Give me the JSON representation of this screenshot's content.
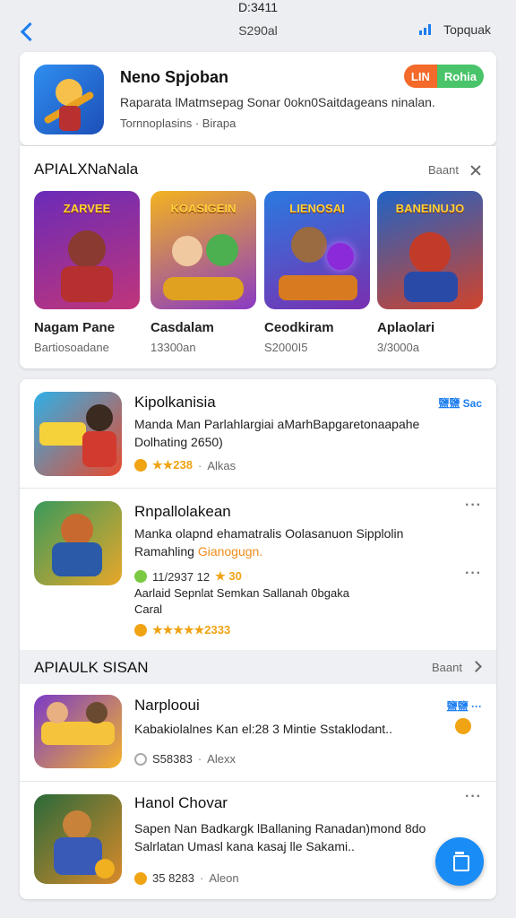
{
  "status": {
    "time": "D:3411"
  },
  "nav": {
    "title": "S290al",
    "right_label": "Topquak",
    "accent": "#1a7cf0"
  },
  "featured": {
    "title": "Neno Spjoban",
    "description": "Raparata lMatmsepag Sonar 0okn0Saitdageans ninalan.",
    "meta": "Tornnoplasins  ·  Birapa",
    "pill_left": "LIN",
    "pill_right": "Rohia"
  },
  "section1": {
    "title": "APIALXNaNala",
    "link": "Baant",
    "tiles": [
      {
        "banner": "ZARVEE",
        "name": "Nagam Pane",
        "sub": "Bartiosoadane",
        "c1": "#6a2bb8",
        "c2": "#c0357a"
      },
      {
        "banner": "KOASIGEIN",
        "name": "Casdalam",
        "sub": "13300an",
        "c1": "#f3b31f",
        "c2": "#8a3ac4"
      },
      {
        "banner": "LIENOSAI",
        "name": "Ceodkiram",
        "sub": "S2000I5",
        "c1": "#2a7ae0",
        "c2": "#7a2fb0"
      },
      {
        "banner": "BANEINUJO",
        "name": "Aplaolari",
        "sub": "3/3000a",
        "c1": "#1f63c6",
        "c2": "#d1432b"
      }
    ]
  },
  "list1": [
    {
      "title": "Kipolkanisia",
      "desc1": "Manda Man Parlahlargiai aMarhBapgaretonaapahe",
      "desc2": "Dolhating 2650)",
      "rating": "★★238",
      "sub": "Alkas",
      "tag": "鹽鹽 Sac",
      "dot": "#f0a313",
      "c1": "#2fb0e8",
      "c2": "#e84a2e"
    },
    {
      "title": "Rnpallolakean",
      "desc1": "Manka olapnd ehamatralis Oolasanuon Sipplolin",
      "desc2": "Ramahling",
      "desc2_hl": "Gianogugn.",
      "rating_prefix": "11/2937 12",
      "rating": "★ 30",
      "extra1": "Aarlaid Sepnlat Semkan Sallanah 0bgaka",
      "extra2": "Caral",
      "rating2": "★★★★★2333",
      "more": "···",
      "dot": "#7ac943",
      "dot2": "#f0a313",
      "c1": "#3a9a5a",
      "c2": "#e8a72a"
    }
  ],
  "section2": {
    "title": "APIAULK SISAN",
    "link": "Baant"
  },
  "list2": [
    {
      "title": "Narplooui",
      "desc1": "Kabakiolalnes Kan el:28 3 Mintie Sstaklodant..",
      "meta": "S58383",
      "sub": "Alexx",
      "tag": "鹽鹽 ···",
      "dot": "#aaaaaa",
      "c1": "#7a3ac8",
      "c2": "#f5b42a"
    },
    {
      "title": "Hanol Chovar",
      "desc1": "Sapen Nan Badkargk lBallaning Ranadan)mond 8do",
      "desc2": "Salrlatan Umasl kana kasaj lle Sakami..",
      "meta": "35 8283",
      "sub": "Aleon",
      "more": "···",
      "dot": "#f0a313",
      "c1": "#2a6a3a",
      "c2": "#d98a2a"
    }
  ]
}
